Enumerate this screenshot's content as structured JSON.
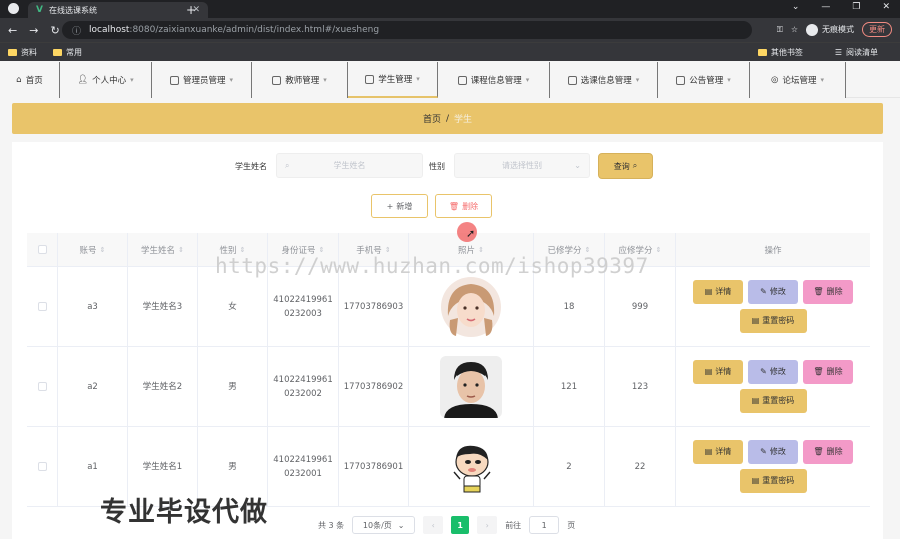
{
  "browser": {
    "tab_title": "在线选课系统",
    "url_host": "localhost",
    "url_path": ":8080/zaixianxuanke/admin/dist/index.html#/xuesheng",
    "incognito_label": "无痕模式",
    "update_label": "更新",
    "bookmarks": [
      "资料",
      "常用"
    ],
    "bookmarks_right": [
      "其他书签",
      "阅读清单"
    ]
  },
  "nav": {
    "items": [
      {
        "label": "首页"
      },
      {
        "label": "个人中心"
      },
      {
        "label": "管理员管理"
      },
      {
        "label": "教师管理"
      },
      {
        "label": "学生管理"
      },
      {
        "label": "课程信息管理"
      },
      {
        "label": "选课信息管理"
      },
      {
        "label": "公告管理"
      },
      {
        "label": "论坛管理"
      }
    ],
    "active_index": 4
  },
  "breadcrumb": {
    "home": "首页",
    "sep": "/",
    "current": "学生"
  },
  "search": {
    "name_label": "学生姓名",
    "name_placeholder": "学生姓名",
    "gender_label": "性别",
    "gender_placeholder": "请选择性别",
    "query_label": "查询"
  },
  "actions": {
    "add_label": "新增",
    "delete_label": "删除"
  },
  "table": {
    "headers": [
      "账号",
      "学生姓名",
      "性别",
      "身份证号",
      "手机号",
      "照片",
      "已修学分",
      "应修学分",
      "操作"
    ],
    "rows": [
      {
        "account": "a3",
        "name": "学生姓名3",
        "gender": "女",
        "id_line1": "41022419961",
        "id_line2": "0232003",
        "phone": "17703786903",
        "earned": "18",
        "required": "999"
      },
      {
        "account": "a2",
        "name": "学生姓名2",
        "gender": "男",
        "id_line1": "41022419961",
        "id_line2": "0232002",
        "phone": "17703786902",
        "earned": "121",
        "required": "123"
      },
      {
        "account": "a1",
        "name": "学生姓名1",
        "gender": "男",
        "id_line1": "41022419961",
        "id_line2": "0232001",
        "phone": "17703786901",
        "earned": "2",
        "required": "22"
      }
    ],
    "ops": {
      "detail": "详情",
      "edit": "修改",
      "remove": "删除",
      "reset": "重置密码"
    }
  },
  "pagination": {
    "total": "共 3 条",
    "page_size": "10条/页",
    "current": "1",
    "goto": "前往",
    "goto_value": "1",
    "page_unit": "页"
  },
  "overlay": {
    "watermark": "https://www.huzhan.com/ishop39397",
    "promo": "专业毕设代做"
  },
  "colors": {
    "accent": "#e9c46a",
    "edit": "#b9bce8",
    "remove": "#f39ac8",
    "page_active": "#19be6b"
  }
}
